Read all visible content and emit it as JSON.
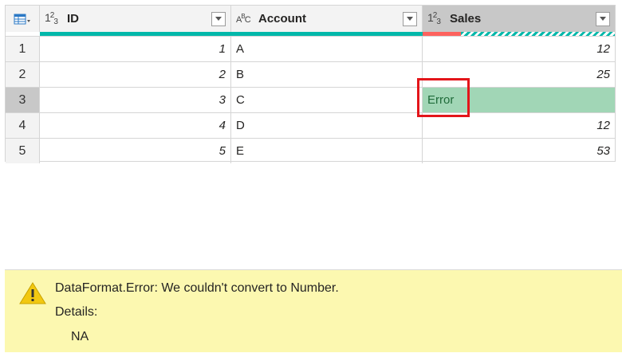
{
  "table": {
    "columns": [
      {
        "type_icon": "123",
        "name": "ID",
        "dropdown": "filter-dropdown"
      },
      {
        "type_icon": "ABC",
        "name": "Account",
        "dropdown": "filter-dropdown"
      },
      {
        "type_icon": "123",
        "name": "Sales",
        "dropdown": "filter-dropdown",
        "selected": true
      }
    ],
    "rows": [
      {
        "n": "1",
        "id": "1",
        "account": "A",
        "sales": "12"
      },
      {
        "n": "2",
        "id": "2",
        "account": "B",
        "sales": "25"
      },
      {
        "n": "3",
        "id": "3",
        "account": "C",
        "sales": "Error"
      },
      {
        "n": "4",
        "id": "4",
        "account": "D",
        "sales": "12"
      },
      {
        "n": "5",
        "id": "5",
        "account": "E",
        "sales": "53"
      }
    ]
  },
  "error_pane": {
    "message": "DataFormat.Error: We couldn't convert to Number.",
    "details_label": "Details:",
    "details_value": "NA"
  },
  "colors": {
    "quality_valid": "#01b8aa",
    "quality_error": "#fd625e",
    "error_cell": "#a1d6b6",
    "highlight_box": "#e3151a",
    "error_pane_bg": "#fcf8b0"
  }
}
